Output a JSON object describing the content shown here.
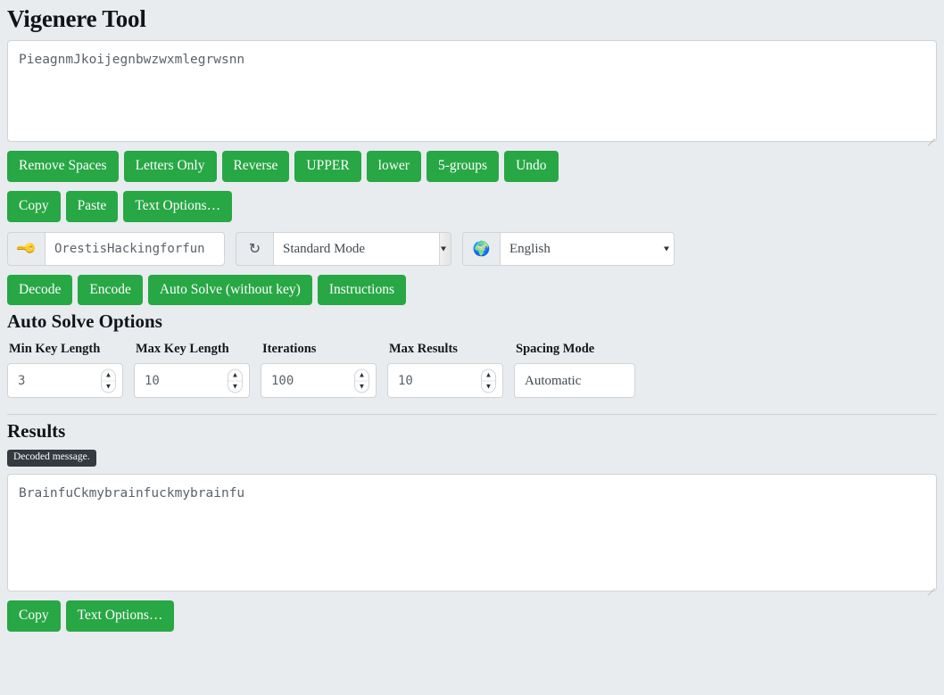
{
  "page": {
    "title": "Vigenere Tool",
    "background_color": "#e8ecef",
    "accent_color": "#28a745"
  },
  "input": {
    "text": "PieagnmJkoijegnbwzwxmlegrwsnn",
    "placeholder": ""
  },
  "transform_buttons": [
    {
      "label": "Remove Spaces",
      "name": "remove-spaces-button"
    },
    {
      "label": "Letters Only",
      "name": "letters-only-button"
    },
    {
      "label": "Reverse",
      "name": "reverse-button"
    },
    {
      "label": "UPPER",
      "name": "upper-button"
    },
    {
      "label": "lower",
      "name": "lower-button"
    },
    {
      "label": "5-groups",
      "name": "five-groups-button"
    },
    {
      "label": "Undo",
      "name": "undo-button"
    }
  ],
  "clipboard_buttons": [
    {
      "label": "Copy",
      "name": "copy-button"
    },
    {
      "label": "Paste",
      "name": "paste-button"
    },
    {
      "label": "Text Options…",
      "name": "text-options-button"
    }
  ],
  "controls": {
    "key_icon": "key-icon",
    "key_value": "OrestisHackingforfun",
    "refresh_icon": "↻",
    "mode_value": "Standard Mode",
    "globe_icon": "🌍",
    "language_value": "English"
  },
  "action_buttons": [
    {
      "label": "Decode",
      "name": "decode-button"
    },
    {
      "label": "Encode",
      "name": "encode-button"
    },
    {
      "label": "Auto Solve (without key)",
      "name": "auto-solve-button"
    },
    {
      "label": "Instructions",
      "name": "instructions-button"
    }
  ],
  "auto_solve": {
    "heading": "Auto Solve Options",
    "fields": [
      {
        "label": "Min Key Length",
        "value": "3",
        "name": "min-key-length"
      },
      {
        "label": "Max Key Length",
        "value": "10",
        "name": "max-key-length"
      },
      {
        "label": "Iterations",
        "value": "100",
        "name": "iterations"
      },
      {
        "label": "Max Results",
        "value": "10",
        "name": "max-results"
      }
    ],
    "spacing_label": "Spacing Mode",
    "spacing_value": "Automatic"
  },
  "results": {
    "heading": "Results",
    "badge": "Decoded message.",
    "text": "BrainfuCkmybrainfuckmybrainfu",
    "buttons": [
      {
        "label": "Copy",
        "name": "result-copy-button"
      },
      {
        "label": "Text Options…",
        "name": "result-text-options-button"
      }
    ]
  }
}
